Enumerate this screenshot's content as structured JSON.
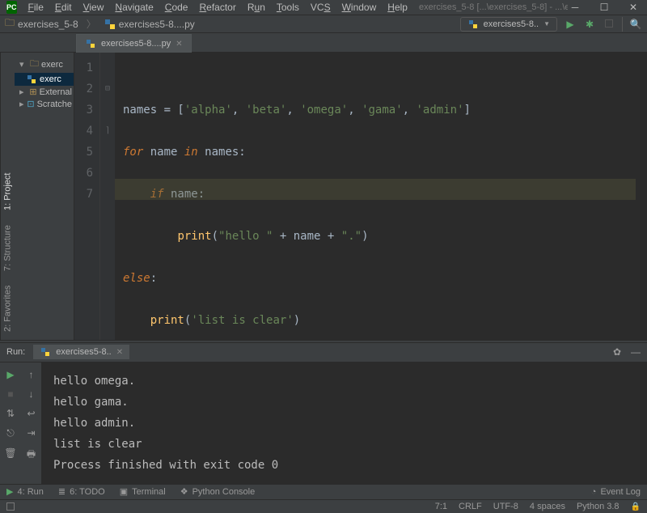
{
  "menu": {
    "file": "File",
    "edit": "Edit",
    "view": "View",
    "navigate": "Navigate",
    "code": "Code",
    "refactor": "Refactor",
    "run": "Run",
    "tools": "Tools",
    "vcs": "VCS",
    "window": "Window",
    "help": "Help"
  },
  "title": "exercises_5-8 [...\\exercises_5-8] - ...\\exercises5-8....py",
  "breadcrumb": {
    "folder": "exercises_5-8",
    "file": "exercises5-8....py"
  },
  "run_config": "exercises5-8..",
  "tab": {
    "name": "exercises5-8....py"
  },
  "tree": {
    "root": "exerc",
    "item1": "exerc",
    "ext": "External",
    "scratch": "Scratche"
  },
  "code_lines": {
    "l1a": "names ",
    "l1b": "= [",
    "l1s1": "'alpha'",
    "l1c": ", ",
    "l1s2": "'beta'",
    "l1s3": "'omega'",
    "l1s4": "'gama'",
    "l1s5": "'admin'",
    "l1d": "]",
    "l2a": "for",
    "l2b": " name ",
    "l2c": "in",
    "l2d": " names:",
    "l3a": "if",
    "l3b": " name:",
    "l4a": "print",
    "l4b": "(",
    "l4s1": "\"hello \"",
    "l4c": " + name + ",
    "l4s2": "\".\"",
    "l4d": ")",
    "l5a": "else",
    "l5b": ":",
    "l6a": "print",
    "l6b": "(",
    "l6s": "'list is clear'",
    "l6c": ")"
  },
  "line_numbers": [
    "1",
    "2",
    "3",
    "4",
    "5",
    "6",
    "7"
  ],
  "run": {
    "label": "Run:",
    "tab": "exercises5-8..",
    "out1": "hello omega.",
    "out2": "hello gama.",
    "out3": "hello admin.",
    "out4": "list is clear",
    "out5": "",
    "out6": "Process finished with exit code 0"
  },
  "bottom": {
    "run": "4: Run",
    "todo": "6: TODO",
    "terminal": "Terminal",
    "pyconsole": "Python Console",
    "eventlog": "Event Log"
  },
  "status": {
    "pos": "7:1",
    "eol": "CRLF",
    "enc": "UTF-8",
    "indent": "4 spaces",
    "sdk": "Python 3.8"
  },
  "side": {
    "project": "1: Project",
    "structure": "7: Structure",
    "favorites": "2: Favorites"
  }
}
